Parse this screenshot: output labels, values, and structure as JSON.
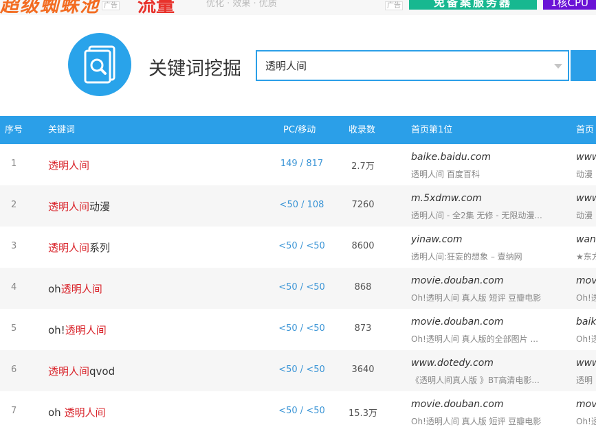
{
  "ads": {
    "logo_text": "超级蜘蛛池",
    "tag": "广告",
    "logo2_text": "流量",
    "mid_text": "优化 · 效果 · 优质",
    "green_text": "免备案服务器",
    "purple_text": "1核CPU"
  },
  "search": {
    "title": "关键词挖掘",
    "value": "透明人间"
  },
  "table": {
    "headers": [
      "序号",
      "关键词",
      "PC/移动",
      "收录数",
      "首页第1位",
      "首页"
    ],
    "rows": [
      {
        "idx": "1",
        "kw_pre": "",
        "kw_hl": "透明人间",
        "kw_post": "",
        "pcm": "149 / 817",
        "count": "2.7万",
        "domain": "baike.baidu.com",
        "sub": "透明人间 百度百科",
        "domain2": "www",
        "sub2": "动漫"
      },
      {
        "idx": "2",
        "kw_pre": "",
        "kw_hl": "透明人间",
        "kw_post": "动漫",
        "pcm": "<50 / 108",
        "count": "7260",
        "domain": "m.5xdmw.com",
        "sub": "透明人间 - 全2集 无修 - 无限动漫...",
        "domain2": "www",
        "sub2": "动漫"
      },
      {
        "idx": "3",
        "kw_pre": "",
        "kw_hl": "透明人间",
        "kw_post": "系列",
        "pcm": "<50 / <50",
        "count": "8600",
        "domain": "yinaw.com",
        "sub": "透明人间:狂妄的想象 – 壹纳网",
        "domain2": "wan",
        "sub2": "★东方"
      },
      {
        "idx": "4",
        "kw_pre": "oh",
        "kw_hl": "透明人间",
        "kw_post": "",
        "pcm": "<50 / <50",
        "count": "868",
        "domain": "movie.douban.com",
        "sub": "Oh!透明人间 真人版 短评 豆瓣电影",
        "domain2": "mov",
        "sub2": "Oh!透"
      },
      {
        "idx": "5",
        "kw_pre": "oh!",
        "kw_hl": "透明人间",
        "kw_post": "",
        "pcm": "<50 / <50",
        "count": "873",
        "domain": "movie.douban.com",
        "sub": "Oh!透明人间 真人版的全部图片 ...",
        "domain2": "baik",
        "sub2": "Oh!透"
      },
      {
        "idx": "6",
        "kw_pre": "",
        "kw_hl": "透明人间",
        "kw_post": "qvod",
        "pcm": "<50 / <50",
        "count": "3640",
        "domain": "www.dotedy.com",
        "sub": "《透明人间真人版 》BT高清电影...",
        "domain2": "www",
        "sub2": "透明"
      },
      {
        "idx": "7",
        "kw_pre": "oh ",
        "kw_hl": "透明人间",
        "kw_post": "",
        "pcm": "<50 / <50",
        "count": "15.3万",
        "domain": "movie.douban.com",
        "sub": "Oh!透明人间 真人版 短评 豆瓣电影",
        "domain2": "mov",
        "sub2": "Oh!透"
      }
    ]
  },
  "colors": {
    "accent": "#2b9fe8",
    "highlight": "#d9242b",
    "link_value": "#3b95d6"
  }
}
